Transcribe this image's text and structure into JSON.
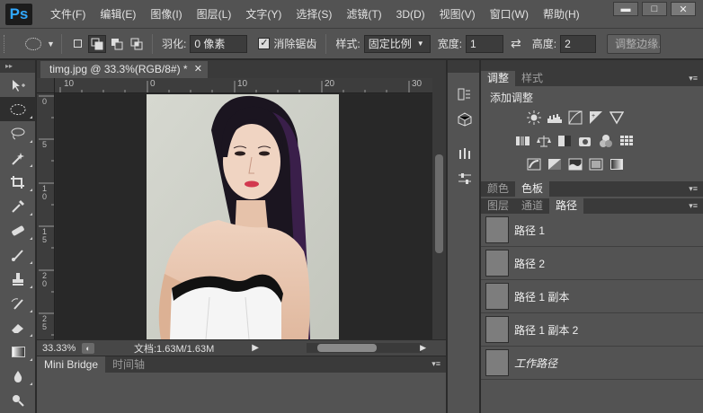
{
  "app": {
    "logo": "Ps"
  },
  "menu": [
    "文件(F)",
    "编辑(E)",
    "图像(I)",
    "图层(L)",
    "文字(Y)",
    "选择(S)",
    "滤镜(T)",
    "3D(D)",
    "视图(V)",
    "窗口(W)",
    "帮助(H)"
  ],
  "window_controls": {
    "minimize": "▬",
    "maximize": "□",
    "close": "✕"
  },
  "options": {
    "feather_label": "羽化:",
    "feather_value": "0 像素",
    "antialias_label": "消除锯齿",
    "antialias_checked": "✓",
    "style_label": "样式:",
    "style_value": "固定比例",
    "width_label": "宽度:",
    "width_value": "1",
    "height_label": "高度:",
    "height_value": "2",
    "refine_edge": "调整边缘..."
  },
  "document": {
    "tab_title": "timg.jpg @ 33.3%(RGB/8#) *",
    "ruler_top": [
      "10",
      "0",
      "10",
      "20",
      "30"
    ],
    "ruler_left": [
      "0",
      "5",
      "1\n0",
      "1\n5",
      "2\n0",
      "2\n5"
    ],
    "zoom": "33.33%",
    "doc_info": "文档:1.63M/1.63M"
  },
  "bottom_panel": {
    "tabs": [
      "Mini Bridge",
      "时间轴"
    ]
  },
  "adjustments": {
    "tabs": [
      "调整",
      "样式"
    ],
    "title": "添加调整"
  },
  "color_panel": {
    "tabs": [
      "颜色",
      "色板"
    ]
  },
  "paths_panel": {
    "tabs": [
      "图层",
      "通道",
      "路径"
    ],
    "items": [
      "路径 1",
      "路径 2",
      "路径 1 副本",
      "路径 1 副本 2",
      "工作路径"
    ]
  },
  "colors": {
    "accent": "#31a8ff",
    "panel": "#535353",
    "dark": "#3a3a3a"
  }
}
